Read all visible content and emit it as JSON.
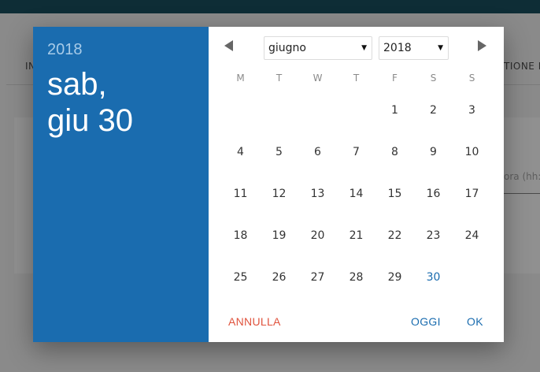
{
  "background": {
    "left_label": "IN",
    "right_label": "TIONE N",
    "input_placeholder": "ora (hh:"
  },
  "header": {
    "year": "2018",
    "date_line1": "sab,",
    "date_line2": "giu 30"
  },
  "navigation": {
    "prev": "previous-month",
    "next": "next-month",
    "month_select": "giugno",
    "year_select": "2018"
  },
  "weekdays": [
    "M",
    "T",
    "W",
    "T",
    "F",
    "S",
    "S"
  ],
  "days": [
    "1",
    "2",
    "3",
    "4",
    "5",
    "6",
    "7",
    "8",
    "9",
    "10",
    "11",
    "12",
    "13",
    "14",
    "15",
    "16",
    "17",
    "18",
    "19",
    "20",
    "21",
    "22",
    "23",
    "24",
    "25",
    "26",
    "27",
    "28",
    "29",
    "30"
  ],
  "first_weekday_index": 4,
  "selected_day": "30",
  "actions": {
    "cancel": "ANNULLA",
    "today": "OGGI",
    "ok": "OK"
  },
  "colors": {
    "accent": "#1a6caf",
    "cancel": "#e0533d",
    "topbar": "#0e2d36"
  }
}
